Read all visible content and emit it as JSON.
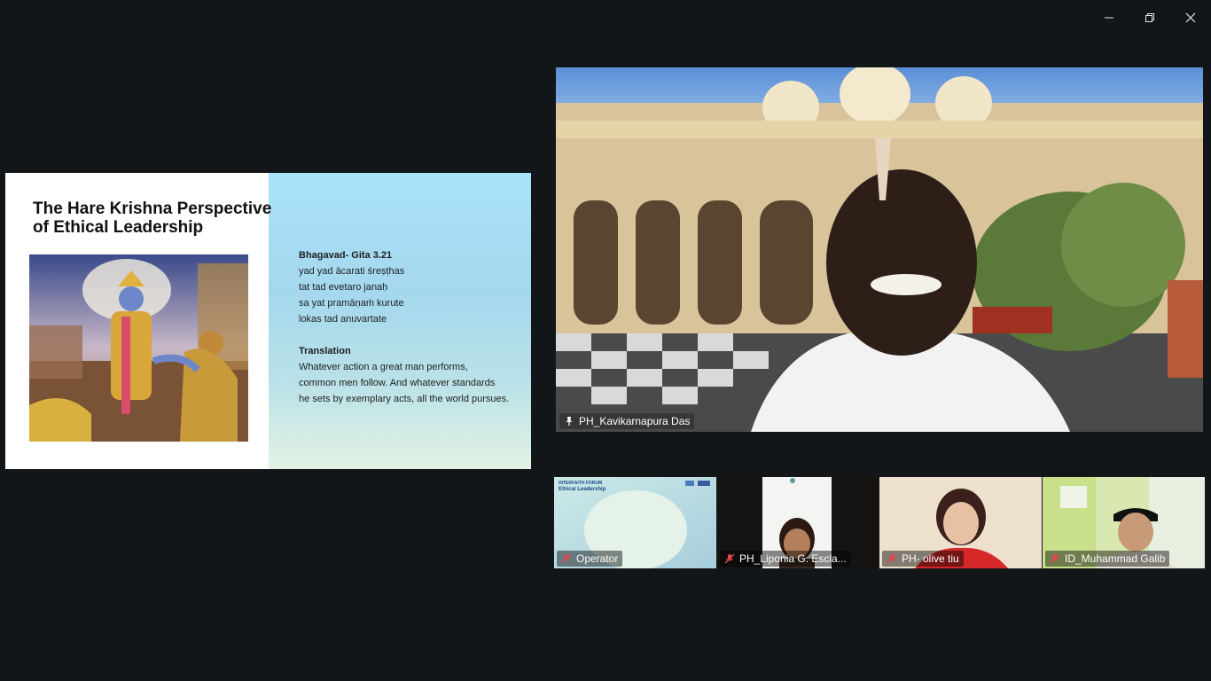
{
  "window": {
    "minimize_icon": "minimize-icon",
    "restore_icon": "restore-icon",
    "close_icon": "close-icon"
  },
  "slide": {
    "title_line1": "The Hare Krishna Perspective",
    "title_line2": "of Ethical Leadership",
    "verse": {
      "heading": "Bhagavad- Gita 3.21",
      "lines": [
        "yad yad ācarati śreṣṭhas",
        "tat tad evetaro janaḥ",
        "sa yat pramāṇaṁ kurute",
        "lokas tad anuvartate"
      ]
    },
    "translation": {
      "heading": "Translation",
      "lines": [
        "Whatever action a great man performs,",
        "common men follow. And whatever standards",
        "he sets by exemplary acts, all the world pursues."
      ]
    }
  },
  "speaker": {
    "name": "PH_Kavikarnapura Das"
  },
  "participants": [
    {
      "name": "Operator",
      "slide_small_title1": "INTERFAITH FORUM",
      "slide_small_title2": "Ethical Leadership"
    },
    {
      "name": "PH_Liponia G. Escla..."
    },
    {
      "name": "PH- olive tiu"
    },
    {
      "name": "ID_Muhammad Galib"
    }
  ],
  "colors": {
    "background": "#131619",
    "muted_mic": "#e5484d"
  }
}
